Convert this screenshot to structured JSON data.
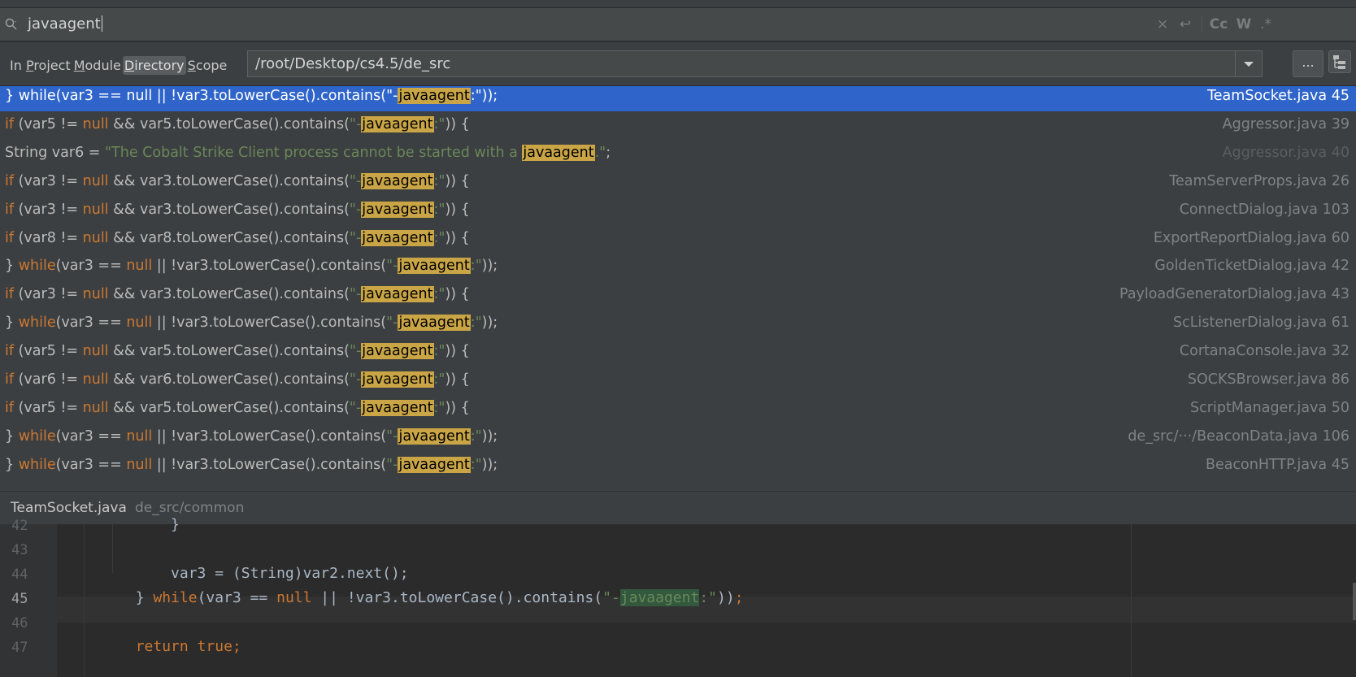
{
  "search": {
    "query": "javaagent",
    "buttons": [
      "×",
      "↩",
      "Cc",
      "W",
      ".*"
    ]
  },
  "scope": {
    "tabs": [
      {
        "prefix": "In ",
        "underline": "P",
        "rest": "roject",
        "active": false
      },
      {
        "prefix": "",
        "underline": "M",
        "rest": "odule",
        "active": false
      },
      {
        "prefix": "",
        "underline": "D",
        "rest": "irectory",
        "active": true
      },
      {
        "prefix": "",
        "underline": "S",
        "rest": "cope",
        "active": false
      }
    ],
    "directory": "/root/Desktop/cs4.5/de_src",
    "browse_label": "..."
  },
  "results": [
    {
      "pre_kw": "} ",
      "kw": "while",
      "mid": "(var3 == ",
      "kw2": "null",
      "post": " || !var3.toLowerCase().contains(",
      "str_pre": "\"-",
      "match": "javaagent",
      "str_post": ":\"",
      "tail": "));",
      "file": "TeamSocket.java",
      "line": "45",
      "selected": true
    },
    {
      "pre_kw": "",
      "kw": "if",
      "mid": " (var5 != ",
      "kw2": "null",
      "post": " && var5.toLowerCase().contains(",
      "str_pre": "\"-",
      "match": "javaagent",
      "str_post": ":\"",
      "tail": ")) {",
      "file": "Aggressor.java",
      "line": "39"
    },
    {
      "pre_kw": "String var6 = ",
      "kw": "",
      "mid": "",
      "kw2": "",
      "post": "",
      "str_pre": "\"The Cobalt Strike Client process cannot be started with a ",
      "match": "javaagent",
      "str_post": ".\"",
      "tail": ";",
      "file": "Aggressor.java",
      "line": "40",
      "dim": true
    },
    {
      "pre_kw": "",
      "kw": "if",
      "mid": " (var3 != ",
      "kw2": "null",
      "post": " && var3.toLowerCase().contains(",
      "str_pre": "\"-",
      "match": "javaagent",
      "str_post": ":\"",
      "tail": ")) {",
      "file": "TeamServerProps.java",
      "line": "26"
    },
    {
      "pre_kw": "",
      "kw": "if",
      "mid": " (var3 != ",
      "kw2": "null",
      "post": " && var3.toLowerCase().contains(",
      "str_pre": "\"-",
      "match": "javaagent",
      "str_post": ":\"",
      "tail": ")) {",
      "file": "ConnectDialog.java",
      "line": "103"
    },
    {
      "pre_kw": "",
      "kw": "if",
      "mid": " (var8 != ",
      "kw2": "null",
      "post": " && var8.toLowerCase().contains(",
      "str_pre": "\"-",
      "match": "javaagent",
      "str_post": ":\"",
      "tail": ")) {",
      "file": "ExportReportDialog.java",
      "line": "60"
    },
    {
      "pre_kw": "} ",
      "kw": "while",
      "mid": "(var3 == ",
      "kw2": "null",
      "post": " || !var3.toLowerCase().contains(",
      "str_pre": "\"-",
      "match": "javaagent",
      "str_post": ":\"",
      "tail": "));",
      "file": "GoldenTicketDialog.java",
      "line": "42"
    },
    {
      "pre_kw": "",
      "kw": "if",
      "mid": " (var3 != ",
      "kw2": "null",
      "post": " && var3.toLowerCase().contains(",
      "str_pre": "\"-",
      "match": "javaagent",
      "str_post": ":\"",
      "tail": ")) {",
      "file": "PayloadGeneratorDialog.java",
      "line": "43"
    },
    {
      "pre_kw": "} ",
      "kw": "while",
      "mid": "(var3 == ",
      "kw2": "null",
      "post": " || !var3.toLowerCase().contains(",
      "str_pre": "\"-",
      "match": "javaagent",
      "str_post": ":\"",
      "tail": "));",
      "file": "ScListenerDialog.java",
      "line": "61"
    },
    {
      "pre_kw": "",
      "kw": "if",
      "mid": " (var5 != ",
      "kw2": "null",
      "post": " && var5.toLowerCase().contains(",
      "str_pre": "\"-",
      "match": "javaagent",
      "str_post": ":\"",
      "tail": ")) {",
      "file": "CortanaConsole.java",
      "line": "32"
    },
    {
      "pre_kw": "",
      "kw": "if",
      "mid": " (var6 != ",
      "kw2": "null",
      "post": " && var6.toLowerCase().contains(",
      "str_pre": "\"-",
      "match": "javaagent",
      "str_post": ":\"",
      "tail": ")) {",
      "file": "SOCKSBrowser.java",
      "line": "86"
    },
    {
      "pre_kw": "",
      "kw": "if",
      "mid": " (var5 != ",
      "kw2": "null",
      "post": " && var5.toLowerCase().contains(",
      "str_pre": "\"-",
      "match": "javaagent",
      "str_post": ":\"",
      "tail": ")) {",
      "file": "ScriptManager.java",
      "line": "50"
    },
    {
      "pre_kw": "} ",
      "kw": "while",
      "mid": "(var3 == ",
      "kw2": "null",
      "post": " || !var3.toLowerCase().contains(",
      "str_pre": "\"-",
      "match": "javaagent",
      "str_post": ":\"",
      "tail": "));",
      "file": "de_src/···/BeaconData.java",
      "line": "106"
    },
    {
      "pre_kw": "} ",
      "kw": "while",
      "mid": "(var3 == ",
      "kw2": "null",
      "post": " || !var3.toLowerCase().contains(",
      "str_pre": "\"-",
      "match": "javaagent",
      "str_post": ":\"",
      "tail": "));",
      "file": "BeaconHTTP.java",
      "line": "45"
    }
  ],
  "preview": {
    "file_name": "TeamSocket.java",
    "file_path": "de_src/common",
    "current_line": "45",
    "lines": [
      {
        "num": "42",
        "segments": [
          {
            "t": "            }",
            "c": ""
          }
        ]
      },
      {
        "num": "43",
        "segments": []
      },
      {
        "num": "44",
        "segments": [
          {
            "t": "            var3 = (String)var2.next();",
            "c": ""
          }
        ]
      },
      {
        "num": "45",
        "segments": [
          {
            "t": "        } ",
            "c": ""
          },
          {
            "t": "while",
            "c": "kw"
          },
          {
            "t": "(var3 == ",
            "c": ""
          },
          {
            "t": "null",
            "c": "kw"
          },
          {
            "t": " || !var3.toLowerCase().contains(",
            "c": ""
          },
          {
            "t": "\"-",
            "c": "str"
          },
          {
            "t": "javaagent",
            "c": "hlg"
          },
          {
            "t": ":\"",
            "c": "str"
          },
          {
            "t": "))",
            "c": ""
          },
          {
            "t": ";",
            "c": "kw"
          }
        ]
      },
      {
        "num": "46",
        "segments": []
      },
      {
        "num": "47",
        "segments": [
          {
            "t": "        ",
            "c": ""
          },
          {
            "t": "return true",
            "c": "kw"
          },
          {
            "t": ";",
            "c": "kw"
          }
        ]
      }
    ]
  }
}
